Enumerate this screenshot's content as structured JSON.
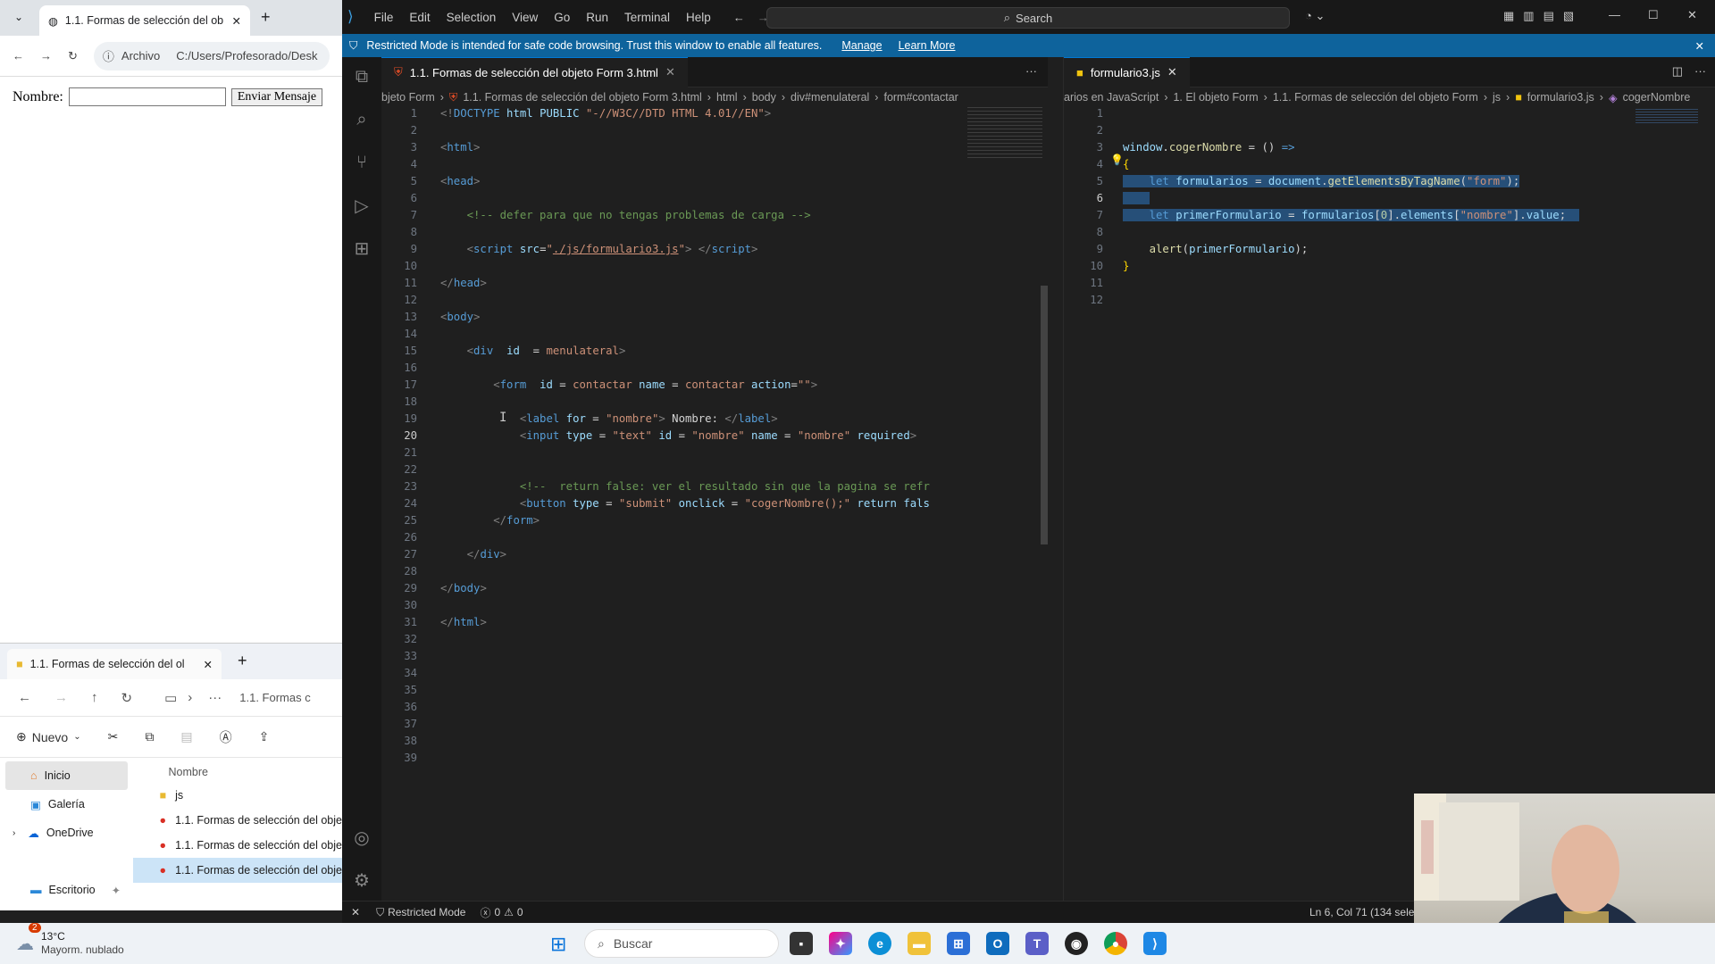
{
  "browser": {
    "tab_title": "1.1. Formas de selección del ob",
    "address_chip": "Archivo",
    "address": "C:/Users/Profesorado/Desk",
    "form_label": "Nombre:",
    "form_button": "Enviar Mensaje"
  },
  "explorer": {
    "tab_title": "1.1. Formas de selección del ol",
    "path_crumb": "1.1. Formas c",
    "new_label": "Nuevo",
    "sidebar": [
      {
        "label": "Inicio",
        "icon": "home-icon"
      },
      {
        "label": "Galería",
        "icon": "gallery-icon"
      },
      {
        "label": "OneDrive",
        "icon": "cloud-icon"
      },
      {
        "label": "Escritorio",
        "icon": "desktop-icon"
      }
    ],
    "list_header": "Nombre",
    "files": [
      {
        "name": "js",
        "icon": "folder-icon"
      },
      {
        "name": "1.1. Formas de selección del obje",
        "icon": "chrome-file-icon"
      },
      {
        "name": "1.1. Formas de selección del obje",
        "icon": "chrome-file-icon"
      },
      {
        "name": "1.1. Formas de selección del obje",
        "icon": "chrome-file-icon"
      }
    ]
  },
  "vscode": {
    "menu": [
      "File",
      "Edit",
      "Selection",
      "View",
      "Go",
      "Run",
      "Terminal",
      "Help"
    ],
    "search_label": "Search",
    "banner": {
      "text": "Restricted Mode is intended for safe code browsing. Trust this window to enable all features.",
      "manage": "Manage",
      "learn": "Learn More"
    },
    "left_tab": "1.1. Formas de selección del objeto Form 3.html",
    "left_crumbs": [
      "bjeto Form",
      "1.1. Formas de selección del objeto Form 3.html",
      "html",
      "body",
      "div#menulateral",
      "form#contactar"
    ],
    "right_tab": "formulario3.js",
    "right_crumbs": [
      "arios en JavaScript",
      "1. El objeto Form",
      "1.1. Formas de selección del objeto Form",
      "js",
      "formulario3.js",
      "cogerNombre"
    ],
    "status": {
      "mode": "Restricted Mode",
      "errors": "0",
      "warnings": "0",
      "position": "Ln 6, Col 71 (134 selec"
    }
  },
  "taskbar": {
    "weather_temp": "13°C",
    "weather_desc": "Mayorm. nublado",
    "search_placeholder": "Buscar",
    "badge": "2"
  },
  "colors": {
    "accent": "#0078d4",
    "banner": "#0e639c",
    "editor_bg": "#1f1f1f"
  }
}
